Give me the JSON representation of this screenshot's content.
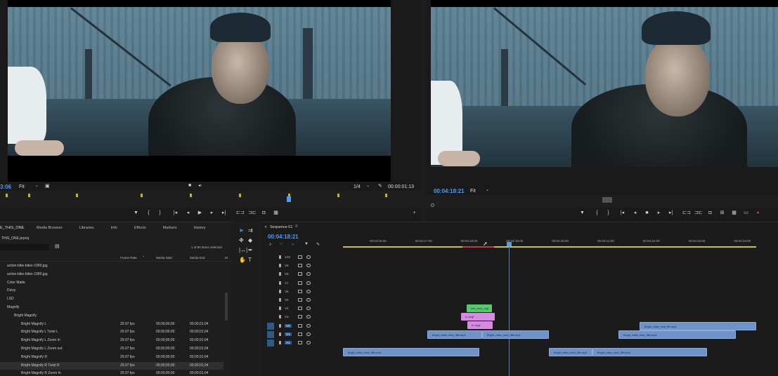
{
  "source_monitor": {
    "timecode_left": "3:06",
    "fit_label": "Fit",
    "fraction": "1/4",
    "timecode_right": "00:00:01:13"
  },
  "program_monitor": {
    "timecode": "00:04:18:21",
    "fit_label": "Fit"
  },
  "project_panel": {
    "tab_active": "E_THIS_ONE",
    "tabs": [
      "Media Browser",
      "Libraries",
      "Info",
      "Effects",
      "Markers",
      "History"
    ],
    "project_file": "THIS_ONE.prproj",
    "selection_status": "1 of 80 items selected",
    "columns": {
      "name": "",
      "frame_rate": "Frame Rate",
      "media_start": "Media Start",
      "media_end": "Media End",
      "m": "M"
    },
    "items": [
      {
        "name": "action-bike-biker-1080.jpg",
        "fps": "",
        "start": "",
        "end": ""
      },
      {
        "name": "action-bike-biker-1080.jpg",
        "fps": "",
        "start": "",
        "end": ""
      },
      {
        "name": "Color Matte",
        "fps": "",
        "start": "",
        "end": ""
      },
      {
        "name": "Dizzy",
        "fps": "",
        "start": "",
        "end": ""
      },
      {
        "name": "LSD",
        "fps": "",
        "start": "",
        "end": ""
      },
      {
        "name": "Magnify",
        "fps": "",
        "start": "",
        "end": ""
      },
      {
        "name": "Bright Magnify",
        "fps": "",
        "start": "",
        "end": ""
      },
      {
        "name": "Bright Magnify L",
        "fps": "29.97 fps",
        "start": "00;00;00;00",
        "end": "00;00;01;04"
      },
      {
        "name": "Bright Magnify L Twist L",
        "fps": "29.97 fps",
        "start": "00;00;00;00",
        "end": "00;00;01;04"
      },
      {
        "name": "Bright Magnify L Zoom In",
        "fps": "29.97 fps",
        "start": "00;00;00;00",
        "end": "00;00;01;04"
      },
      {
        "name": "Bright Magnify L Zoom out",
        "fps": "29.97 fps",
        "start": "00;00;00;00",
        "end": "00;00;01;04"
      },
      {
        "name": "Bright Magnify R",
        "fps": "29.97 fps",
        "start": "00;00;00;00",
        "end": "00;00;01;04"
      },
      {
        "name": "Bright Magnify R Twist R",
        "fps": "29.97 fps",
        "start": "00;00;00;00",
        "end": "00;00;01;04"
      },
      {
        "name": "Bright Magnify R Zoom In",
        "fps": "29.97 fps",
        "start": "00;00;00;00",
        "end": "00;00;01;04"
      }
    ]
  },
  "timeline": {
    "tab": "Sequence 01",
    "timecode": "00:04:18:21",
    "ruler_times": [
      "00:04:16:00",
      "00:04:17:00",
      "00:04:18:00",
      "00:04:19:00",
      "00:04:20:00",
      "00:04:21:00",
      "00:04:22:00",
      "00:04:23:00",
      "00:04:24:00"
    ],
    "tracks": [
      "V10",
      "V9",
      "V8",
      "V7",
      "V6",
      "V5",
      "V4",
      "V3",
      "V2",
      "V1",
      "A1"
    ],
    "clips": [
      {
        "label": "bnd_elem_mgf",
        "color": "green"
      },
      {
        "label": "fx 1mgf",
        "color": "pink"
      },
      {
        "label": "fx 1mgf",
        "color": "pink"
      },
      {
        "label": "Bright_videz_mod_fliv.mp4",
        "color": "blue"
      },
      {
        "label": "Bright_videz_mod_3fliv.mp4",
        "color": "blue"
      },
      {
        "label": "Bright_videz_mod_3fliv.mp4",
        "color": "blue"
      },
      {
        "label": "Bright_videz_mod_3fliv.mp4",
        "color": "blue"
      },
      {
        "label": "Bright_videz_mod_3fliv.mp4",
        "color": "blue"
      },
      {
        "label": "Bright_videz_mod_3fliv.mp4",
        "color": "blue"
      },
      {
        "label": "Bright_videz_mod_3fliv.mp4",
        "color": "blue"
      }
    ]
  }
}
